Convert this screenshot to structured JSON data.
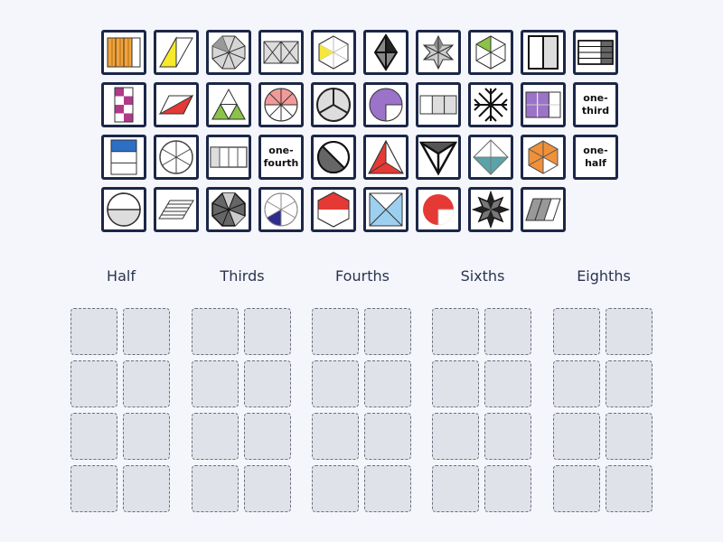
{
  "colors": {
    "page_bg": "#f4f6fb",
    "tile_border": "#1c2747",
    "slot_bg": "#e0e2ea",
    "slot_border": "#6b6f7d"
  },
  "tiles": [
    {
      "name": "tile-orange-rectangle-fraction-icon"
    },
    {
      "name": "tile-yellow-parallelogram-half-icon"
    },
    {
      "name": "tile-gray-octagon-fraction-icon"
    },
    {
      "name": "tile-rectangle-x-fourths-icon"
    },
    {
      "name": "tile-yellow-hexagon-sixths-icon"
    },
    {
      "name": "tile-black-diamond-fourths-icon"
    },
    {
      "name": "tile-gray-star-sixths-icon"
    },
    {
      "name": "tile-green-hexagon-sixths-icon"
    },
    {
      "name": "tile-gray-rectangle-half-icon"
    },
    {
      "name": "tile-gray-grid-rectangle-icon"
    },
    {
      "name": "tile-magenta-checker-icon"
    },
    {
      "name": "tile-red-parallelogram-half-icon"
    },
    {
      "name": "tile-green-triangle-fourths-icon"
    },
    {
      "name": "tile-pink-circle-eighths-icon"
    },
    {
      "name": "tile-gray-circle-thirds-icon"
    },
    {
      "name": "tile-purple-circle-fourths-icon"
    },
    {
      "name": "tile-gray-rectangle-thirds-icon"
    },
    {
      "name": "tile-black-star-eighths-icon"
    },
    {
      "name": "tile-purple-grid-sixths-icon"
    },
    {
      "name": "tile-text-one-third",
      "text": "one-\nthird"
    },
    {
      "name": "tile-blue-rectangle-thirds-icon"
    },
    {
      "name": "tile-gray-circle-sixths-icon"
    },
    {
      "name": "tile-gray-rectangle-fourths-icon"
    },
    {
      "name": "tile-text-one-fourth",
      "text": "one-\nfourth"
    },
    {
      "name": "tile-gray-circle-half-diagonal-icon"
    },
    {
      "name": "tile-red-triangle-thirds-icon"
    },
    {
      "name": "tile-black-triangle-thirds-icon"
    },
    {
      "name": "tile-teal-diamond-fourths-icon"
    },
    {
      "name": "tile-orange-hexagon-sixths-icon"
    },
    {
      "name": "tile-text-one-half",
      "text": "one-\nhalf"
    },
    {
      "name": "tile-gray-circle-half-icon"
    },
    {
      "name": "tile-striped-parallelogram-icon"
    },
    {
      "name": "tile-black-octagon-eighths-icon"
    },
    {
      "name": "tile-navy-circle-sixths-icon"
    },
    {
      "name": "tile-red-hexagon-half-icon"
    },
    {
      "name": "tile-blue-square-fourths-icon"
    },
    {
      "name": "tile-red-circle-fourths-icon"
    },
    {
      "name": "tile-black-star-eighths-2-icon"
    },
    {
      "name": "tile-gray-parallelogram-thirds-icon"
    }
  ],
  "categories": [
    {
      "label": "Half"
    },
    {
      "label": "Thirds"
    },
    {
      "label": "Fourths"
    },
    {
      "label": "Sixths"
    },
    {
      "label": "Eighths"
    }
  ]
}
